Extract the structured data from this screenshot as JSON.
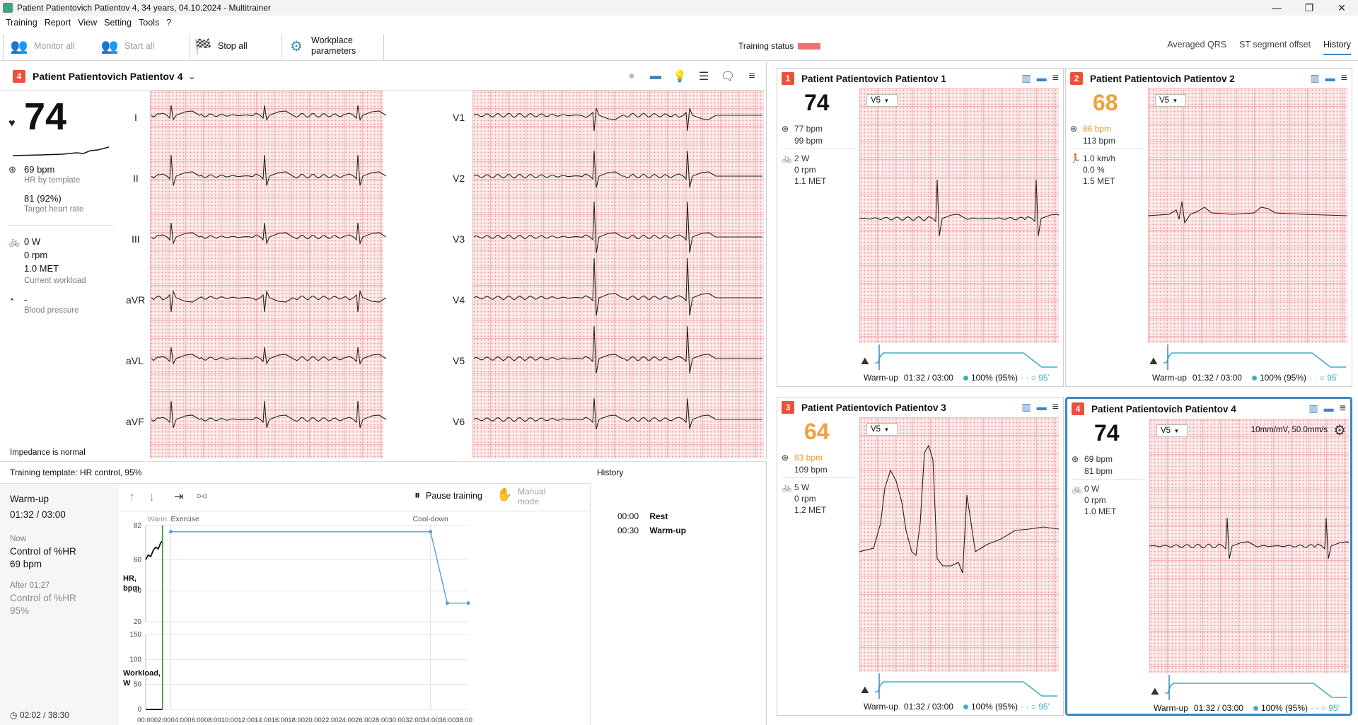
{
  "window": {
    "title": "Patient Patientovich Patientov 4, 34 years, 04.10.2024 - Multitrainer",
    "controls": [
      "—",
      "❐",
      "✕"
    ]
  },
  "menu": [
    "Training",
    "Report",
    "View",
    "Setting",
    "Tools",
    "?"
  ],
  "toolbar": {
    "monitor_all": "Monitor all",
    "start_all": "Start all",
    "stop_all": "Stop all",
    "workplace_line1": "Workplace",
    "workplace_line2": "parameters",
    "training_status": "Training status",
    "status_color": "#f07070",
    "view_tabs": [
      "Averaged QRS",
      "ST segment offset",
      "History"
    ],
    "active_view": "History"
  },
  "main": {
    "patient_number": "4",
    "patient_name": "Patient Patientovich Patientov 4",
    "hr": "74",
    "hr_template": "69 bpm",
    "hr_template_label": "HR by template",
    "target_hr": "81 (92%)",
    "target_hr_label": "Target heart rate",
    "workload": "0 W",
    "rpm": "0 rpm",
    "met": "1.0 MET",
    "workload_label": "Current workload",
    "bp": "-",
    "bp_label": "Blood pressure",
    "impedance": "Impedance is normal",
    "leads_left": [
      "I",
      "II",
      "III",
      "aVR",
      "aVL",
      "aVF"
    ],
    "leads_right": [
      "V1",
      "V2",
      "V3",
      "V4",
      "V5",
      "V6"
    ]
  },
  "training": {
    "template_label": "Training template: HR control, 95%",
    "history_title": "History",
    "stage": "Warm-up",
    "stage_time": "01:32 / 03:00",
    "now_label": "Now",
    "now_control": "Control of %HR",
    "now_value": "69 bpm",
    "after_label": "After 01:27",
    "after_control": "Control of %HR",
    "after_value": "95%",
    "total_time": "02:02 / 38:30",
    "pause_label": "Pause training",
    "manual_line1": "Manual",
    "manual_line2": "mode",
    "history": [
      {
        "time": "00:00",
        "event": "Rest"
      },
      {
        "time": "00:30",
        "event": "Warm-up"
      }
    ]
  },
  "chart_data": {
    "type": "line",
    "phases": [
      "Warm...",
      "Exercise",
      "Cool-down"
    ],
    "hr_axis": {
      "label": "HR, bpm",
      "ticks": [
        20,
        40,
        60,
        82
      ],
      "ylim": [
        20,
        82
      ]
    },
    "workload_axis": {
      "label": "Workload, W",
      "ticks": [
        0,
        50,
        100,
        150
      ],
      "ylim": [
        0,
        150
      ]
    },
    "x_ticks": [
      "00:00",
      "02:00",
      "04:00",
      "06:00",
      "08:00",
      "10:00",
      "12:00",
      "14:00",
      "16:00",
      "18:00",
      "20:00",
      "22:00",
      "24:00",
      "26:00",
      "28:00",
      "30:00",
      "32:00",
      "34:00",
      "36:00",
      "38:00"
    ],
    "x_minutes": [
      0,
      38.5
    ],
    "target_hr_series": {
      "x": [
        3,
        34,
        36,
        38.5
      ],
      "y": [
        78,
        78,
        32,
        32
      ]
    },
    "actual_hr_series": {
      "x": [
        0,
        0.3,
        0.6,
        0.9,
        1.2,
        1.5,
        1.8,
        2.0
      ],
      "y": [
        60,
        63,
        62,
        66,
        68,
        67,
        71,
        72
      ]
    },
    "workload_series": {
      "x": [
        0,
        2.0
      ],
      "y": [
        0,
        0
      ]
    },
    "current_minute": 2.0
  },
  "tiles": [
    {
      "number": "1",
      "name": "Patient Patientovich Patientov 1",
      "hr": "74",
      "hr_color": "#111111",
      "hr1": "77 bpm",
      "hr2": "99 bpm",
      "w1": "2 W",
      "w2": "0 rpm",
      "w3": "1.1 MET",
      "device": "bike",
      "lead": "V5",
      "stage": "Warm-up",
      "time": "01:32 / 03:00",
      "pct": "100% (95%)",
      "tail": "· · ○ 95'",
      "selected": false
    },
    {
      "number": "2",
      "name": "Patient Patientovich Patientov 2",
      "hr": "68",
      "hr_color": "#f0a03c",
      "hr1": "86 bpm",
      "hr2": "113 bpm",
      "w1": "1.0 km/h",
      "w2": "0.0 %",
      "w3": "1.5 MET",
      "device": "treadmill",
      "lead": "V5",
      "stage": "Warm-up",
      "time": "01:32 / 03:00",
      "pct": "100% (95%)",
      "tail": "· · ○ 95'",
      "selected": false
    },
    {
      "number": "3",
      "name": "Patient Patientovich Patientov 3",
      "hr": "64",
      "hr_color": "#f0a03c",
      "hr1": "83 bpm",
      "hr2": "109 bpm",
      "w1": "5 W",
      "w2": "0 rpm",
      "w3": "1.2 MET",
      "device": "bike",
      "lead": "V5",
      "stage": "Warm-up",
      "time": "01:32 / 03:00",
      "pct": "100% (95%)",
      "tail": "· · ○ 95'",
      "selected": false
    },
    {
      "number": "4",
      "name": "Patient Patientovich Patientov 4",
      "hr": "74",
      "hr_color": "#111111",
      "hr1": "69 bpm",
      "hr2": "81 bpm",
      "w1": "0 W",
      "w2": "0 rpm",
      "w3": "1.0 MET",
      "device": "bike",
      "lead": "V5",
      "stage": "Warm-up",
      "time": "01:32 / 03:00",
      "pct": "100% (95%)",
      "tail": "· · ○ 95'",
      "selected": true,
      "scale": "10mm/mV, 50.0mm/s"
    }
  ]
}
